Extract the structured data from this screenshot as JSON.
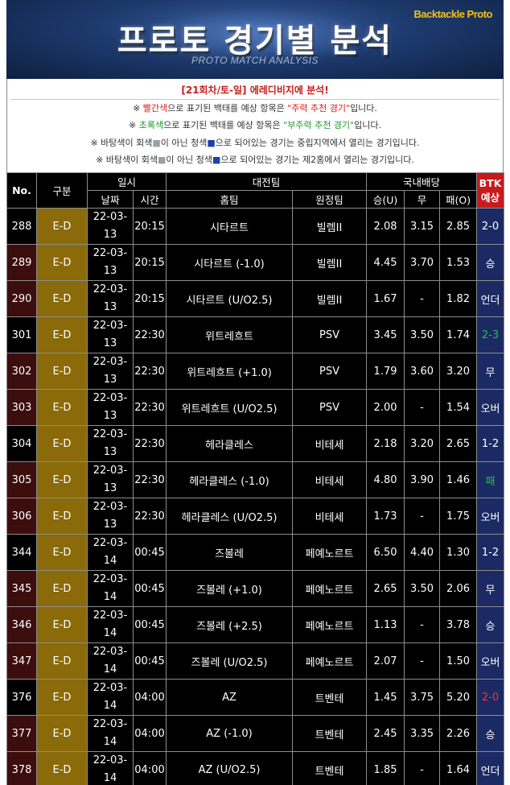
{
  "header": {
    "brand": "Backtackle Proto",
    "title": "프로토 경기별 분석",
    "subtitle": "PROTO MATCH ANALYSIS"
  },
  "notice": {
    "round_title": "[21회차/토-일] 에레디비지에 분석!",
    "line1": {
      "a": "※ ",
      "b": "빨간색",
      "c": "으로 표기된 백태를 예상 항목은 ",
      "d": "\"주력 추천 경기\"",
      "e": "입니다."
    },
    "line2": {
      "a": "※ ",
      "b": "초록색",
      "c": "으로 표기된 백태를 예상 항목은 ",
      "d": "\"부주력 추천 경기\"",
      "e": "입니다."
    },
    "line3": {
      "a": "※ 바탕색이 회색",
      "b": "■",
      "c": "이 아닌 청색",
      "d": "■",
      "e": "으로 되어있는 경기는 중립지역에서 열리는 경기입니다."
    },
    "line4": {
      "a": "※ 바탕색이 회색",
      "b": "■",
      "c": "이 아닌 청색",
      "d": "■",
      "e": "으로 되어있는 경기는 제2홈에서 열리는 경기입니다."
    },
    "colors": {
      "red": "#e01818",
      "green": "#1d9a2a",
      "blue": "#1d3fae",
      "gray": "#9aa0a8"
    }
  },
  "table": {
    "headers": {
      "no": "No.",
      "category": "구분",
      "datetime": "일시",
      "date": "날짜",
      "time": "시간",
      "match": "대전팀",
      "home": "홈팀",
      "away": "원정팀",
      "odds": "국내배당",
      "win": "승(U)",
      "draw": "무",
      "loss": "패(O)",
      "btk_line1": "BTK",
      "btk_line2": "예상"
    },
    "rows": [
      {
        "no": "288",
        "cat": "E-D",
        "date": "22-03-13",
        "time": "20:15",
        "home": "시타르트",
        "away": "빌렘II",
        "win": "2.08",
        "draw": "3.15",
        "loss": "2.85",
        "btk": "2-0",
        "btk_color": "white",
        "shade": "black"
      },
      {
        "no": "289",
        "cat": "E-D",
        "date": "22-03-13",
        "time": "20:15",
        "home": "시타르트 (-1.0)",
        "away": "빌렘II",
        "win": "4.45",
        "draw": "3.70",
        "loss": "1.53",
        "btk": "승",
        "btk_color": "white",
        "shade": "maroon"
      },
      {
        "no": "290",
        "cat": "E-D",
        "date": "22-03-13",
        "time": "20:15",
        "home": "시타르트 (U/O2.5)",
        "away": "빌렘II",
        "win": "1.67",
        "draw": "-",
        "loss": "1.82",
        "btk": "언더",
        "btk_color": "white",
        "shade": "maroon"
      },
      {
        "no": "301",
        "cat": "E-D",
        "date": "22-03-13",
        "time": "22:30",
        "home": "위트레흐트",
        "away": "PSV",
        "win": "3.45",
        "draw": "3.50",
        "loss": "1.74",
        "btk": "2-3",
        "btk_color": "green",
        "shade": "black"
      },
      {
        "no": "302",
        "cat": "E-D",
        "date": "22-03-13",
        "time": "22:30",
        "home": "위트레흐트 (+1.0)",
        "away": "PSV",
        "win": "1.79",
        "draw": "3.60",
        "loss": "3.20",
        "btk": "무",
        "btk_color": "white",
        "shade": "maroon"
      },
      {
        "no": "303",
        "cat": "E-D",
        "date": "22-03-13",
        "time": "22:30",
        "home": "위트레흐트 (U/O2.5)",
        "away": "PSV",
        "win": "2.00",
        "draw": "-",
        "loss": "1.54",
        "btk": "오버",
        "btk_color": "white",
        "shade": "maroon"
      },
      {
        "no": "304",
        "cat": "E-D",
        "date": "22-03-13",
        "time": "22:30",
        "home": "헤라클레스",
        "away": "비테세",
        "win": "2.18",
        "draw": "3.20",
        "loss": "2.65",
        "btk": "1-2",
        "btk_color": "white",
        "shade": "black"
      },
      {
        "no": "305",
        "cat": "E-D",
        "date": "22-03-13",
        "time": "22:30",
        "home": "헤라클레스 (-1.0)",
        "away": "비테세",
        "win": "4.80",
        "draw": "3.90",
        "loss": "1.46",
        "btk": "패",
        "btk_color": "green",
        "shade": "maroon"
      },
      {
        "no": "306",
        "cat": "E-D",
        "date": "22-03-13",
        "time": "22:30",
        "home": "헤라클레스 (U/O2.5)",
        "away": "비테세",
        "win": "1.73",
        "draw": "-",
        "loss": "1.75",
        "btk": "오버",
        "btk_color": "white",
        "shade": "maroon"
      },
      {
        "no": "344",
        "cat": "E-D",
        "date": "22-03-14",
        "time": "00:45",
        "home": "즈볼레",
        "away": "페예노르트",
        "win": "6.50",
        "draw": "4.40",
        "loss": "1.30",
        "btk": "1-2",
        "btk_color": "white",
        "shade": "black"
      },
      {
        "no": "345",
        "cat": "E-D",
        "date": "22-03-14",
        "time": "00:45",
        "home": "즈볼레 (+1.0)",
        "away": "페예노르트",
        "win": "2.65",
        "draw": "3.50",
        "loss": "2.06",
        "btk": "무",
        "btk_color": "white",
        "shade": "maroon"
      },
      {
        "no": "346",
        "cat": "E-D",
        "date": "22-03-14",
        "time": "00:45",
        "home": "즈볼레 (+2.5)",
        "away": "페예노르트",
        "win": "1.13",
        "draw": "-",
        "loss": "3.78",
        "btk": "승",
        "btk_color": "white",
        "shade": "maroon"
      },
      {
        "no": "347",
        "cat": "E-D",
        "date": "22-03-14",
        "time": "00:45",
        "home": "즈볼레 (U/O2.5)",
        "away": "페예노르트",
        "win": "2.07",
        "draw": "-",
        "loss": "1.50",
        "btk": "오버",
        "btk_color": "white",
        "shade": "maroon"
      },
      {
        "no": "376",
        "cat": "E-D",
        "date": "22-03-14",
        "time": "04:00",
        "home": "AZ",
        "away": "트벤테",
        "win": "1.45",
        "draw": "3.75",
        "loss": "5.20",
        "btk": "2-0",
        "btk_color": "red",
        "shade": "black"
      },
      {
        "no": "377",
        "cat": "E-D",
        "date": "22-03-14",
        "time": "04:00",
        "home": "AZ (-1.0)",
        "away": "트벤테",
        "win": "2.45",
        "draw": "3.35",
        "loss": "2.26",
        "btk": "승",
        "btk_color": "white",
        "shade": "maroon"
      },
      {
        "no": "378",
        "cat": "E-D",
        "date": "22-03-14",
        "time": "04:00",
        "home": "AZ (U/O2.5)",
        "away": "트벤테",
        "win": "1.85",
        "draw": "-",
        "loss": "1.64",
        "btk": "언더",
        "btk_color": "white",
        "shade": "maroon"
      }
    ]
  }
}
